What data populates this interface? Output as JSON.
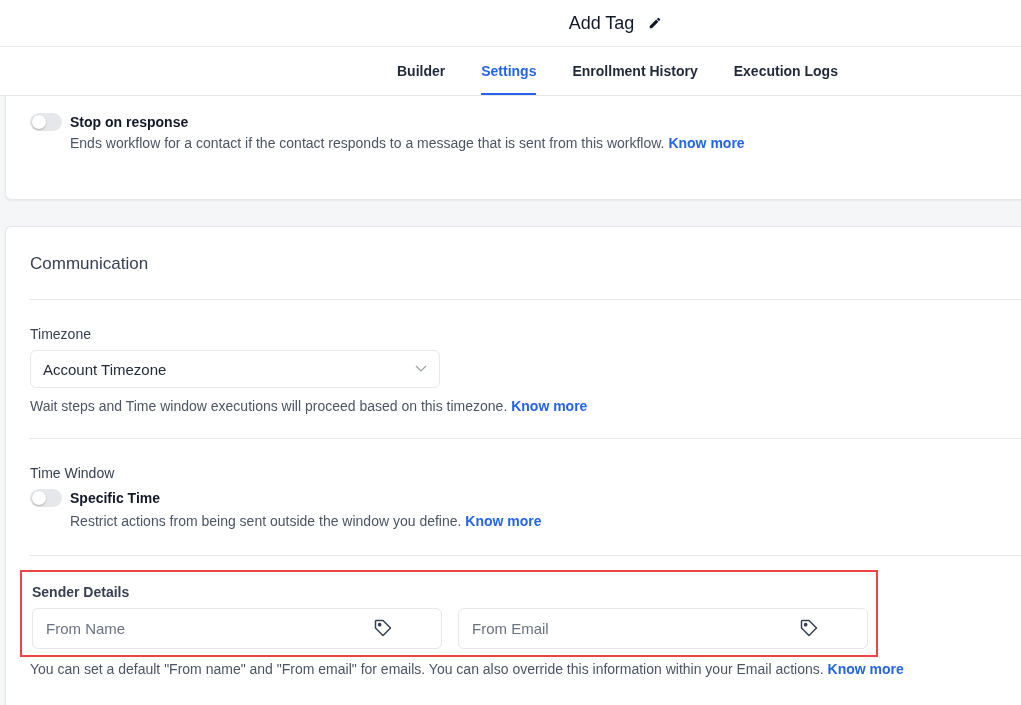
{
  "header": {
    "title": "Add Tag"
  },
  "tabs": [
    {
      "label": "Builder",
      "selected": false
    },
    {
      "label": "Settings",
      "selected": true
    },
    {
      "label": "Enrollment History",
      "selected": false
    },
    {
      "label": "Execution Logs",
      "selected": false
    }
  ],
  "stop_on_response": {
    "label": "Stop on response",
    "on": false,
    "description": "Ends workflow for a contact if the contact responds to a message that is sent from this workflow.",
    "link": "Know more"
  },
  "communication": {
    "title": "Communication",
    "timezone": {
      "label": "Timezone",
      "value": "Account Timezone",
      "help": "Wait steps and Time window executions will proceed based on this timezone.",
      "link": "Know more"
    },
    "time_window": {
      "label": "Time Window",
      "toggle_label": "Specific Time",
      "on": false,
      "help": "Restrict actions from being sent outside the window you define.",
      "link": "Know more"
    },
    "sender_details": {
      "label": "Sender Details",
      "highlighted": true,
      "fields": [
        {
          "placeholder": "From Name"
        },
        {
          "placeholder": "From Email"
        }
      ],
      "help": "You can set a default \"From name\" and \"From email\" for emails. You can also override this information within your Email actions.",
      "link": "Know more"
    }
  }
}
